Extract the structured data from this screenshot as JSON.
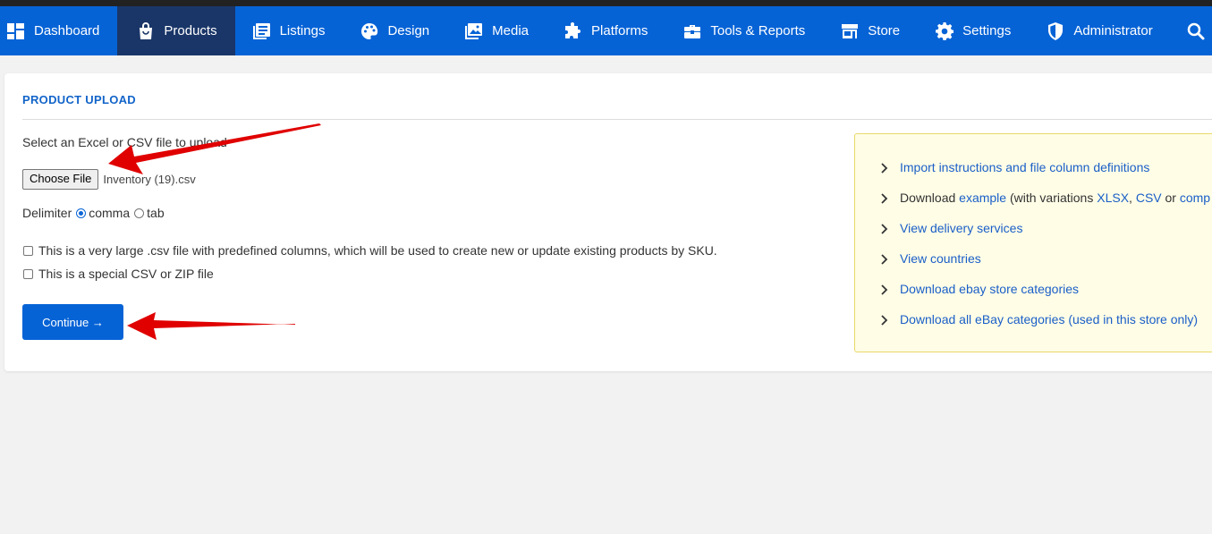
{
  "nav": {
    "items": [
      {
        "label": "Dashboard",
        "icon": "dashboard-icon"
      },
      {
        "label": "Products",
        "icon": "shopping-bag-icon"
      },
      {
        "label": "Listings",
        "icon": "listings-icon"
      },
      {
        "label": "Design",
        "icon": "palette-icon"
      },
      {
        "label": "Media",
        "icon": "image-icon"
      },
      {
        "label": "Platforms",
        "icon": "puzzle-icon"
      },
      {
        "label": "Tools & Reports",
        "icon": "toolbox-icon"
      },
      {
        "label": "Store",
        "icon": "store-icon"
      },
      {
        "label": "Settings",
        "icon": "gear-icon"
      },
      {
        "label": "Administrator",
        "icon": "shield-icon"
      }
    ],
    "active": "Products",
    "search_icon": "search-icon"
  },
  "upload": {
    "title": "PRODUCT UPLOAD",
    "select_label": "Select an Excel or CSV file to upload",
    "choose_file_label": "Choose File",
    "file_name": "Inventory (19).csv",
    "delimiter_label": "Delimiter",
    "delimiter_options": [
      "comma",
      "tab"
    ],
    "delimiter_selected": "comma",
    "checkbox_large_csv": "This is a very large .csv file with predefined columns, which will be used to create new or update existing products by SKU.",
    "checkbox_special": "This is a special CSV or ZIP file",
    "continue_label": "Continue →"
  },
  "info": {
    "import_instructions": "Import instructions and file column definitions",
    "download_prefix": "Download ",
    "example_link": "example",
    "variations_text": " (with variations ",
    "xlsx_link": "XLSX",
    "comma_sep": ", ",
    "csv_link": "CSV",
    "or_text": " or ",
    "comp_link": "comp",
    "delivery_services": "View delivery services",
    "countries": "View countries",
    "ebay_store_categories": "Download ebay store categories",
    "all_ebay_categories": "Download all eBay categories (used in this store only)"
  },
  "colors": {
    "nav_bg": "#0663d6",
    "nav_active": "#1a3668",
    "accent": "#1264c9",
    "annotation_arrow": "#e00000",
    "info_bg": "#fffde6"
  }
}
